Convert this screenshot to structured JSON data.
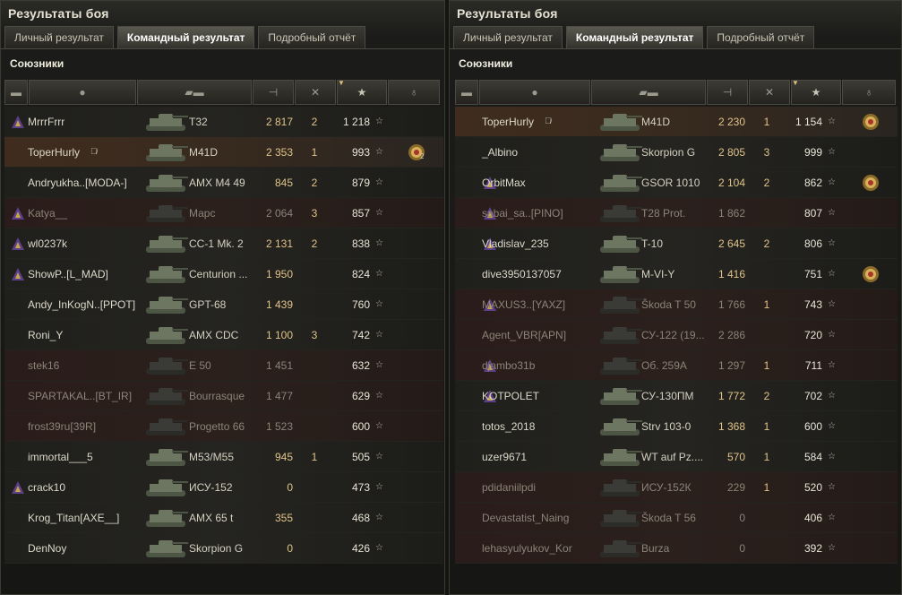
{
  "left": {
    "title": "Результаты боя",
    "tabs": [
      "Личный результат",
      "Командный результат",
      "Подробный отчёт"
    ],
    "active_tab": 1,
    "section": "Союзники",
    "rows": [
      {
        "name": "MrrrFrrr",
        "vehicle": "T32",
        "damage": "2 817",
        "kills": "2",
        "exp": "1 218",
        "badge": "clan",
        "state": "normal"
      },
      {
        "name": "ToperHurly",
        "vehicle": "M41D",
        "damage": "2 353",
        "kills": "1",
        "exp": "993",
        "state": "self",
        "eye": true,
        "medal": "2"
      },
      {
        "name": "Andryukha..[MODA-]",
        "vehicle": "AMX M4 49",
        "damage": "845",
        "kills": "2",
        "exp": "879",
        "state": "normal"
      },
      {
        "name": "Katya__",
        "vehicle": "Марс",
        "damage": "2 064",
        "kills": "3",
        "exp": "857",
        "badge": "clan",
        "state": "dead"
      },
      {
        "name": "wl0237k",
        "vehicle": "CC-1 Mk. 2",
        "damage": "2 131",
        "kills": "2",
        "exp": "838",
        "badge": "clan",
        "state": "normal"
      },
      {
        "name": "ShowP..[L_MAD]",
        "vehicle": "Centurion ...",
        "damage": "1 950",
        "kills": "",
        "exp": "824",
        "badge": "clan",
        "state": "normal"
      },
      {
        "name": "Andy_InKogN..[PPOT]",
        "vehicle": "GPT-68",
        "damage": "1 439",
        "kills": "",
        "exp": "760",
        "state": "normal"
      },
      {
        "name": "Roni_Y",
        "vehicle": "AMX CDC",
        "damage": "1 100",
        "kills": "3",
        "exp": "742",
        "state": "normal"
      },
      {
        "name": "stek16",
        "vehicle": "E 50",
        "damage": "1 451",
        "kills": "",
        "exp": "632",
        "state": "dead"
      },
      {
        "name": "SPARTAKAL..[BT_IR]",
        "vehicle": "Bourrasque",
        "damage": "1 477",
        "kills": "",
        "exp": "629",
        "state": "dead"
      },
      {
        "name": "frost39ru[39R]",
        "vehicle": "Progetto 66",
        "damage": "1 523",
        "kills": "",
        "exp": "600",
        "state": "dead"
      },
      {
        "name": "immortal___5",
        "vehicle": "M53/M55",
        "damage": "945",
        "kills": "1",
        "exp": "505",
        "state": "normal"
      },
      {
        "name": "crack10",
        "vehicle": "ИСУ-152",
        "damage": "0",
        "kills": "",
        "exp": "473",
        "badge": "clan",
        "state": "normal"
      },
      {
        "name": "Krog_Titan[AXE__]",
        "vehicle": "AMX 65 t",
        "damage": "355",
        "kills": "",
        "exp": "468",
        "state": "normal"
      },
      {
        "name": "DenNoy",
        "vehicle": "Skorpion G",
        "damage": "0",
        "kills": "",
        "exp": "426",
        "state": "normal"
      }
    ]
  },
  "right": {
    "title": "Результаты боя",
    "tabs": [
      "Личный результат",
      "Командный результат",
      "Подробный отчёт"
    ],
    "active_tab": 1,
    "section": "Союзники",
    "rows": [
      {
        "name": "ToperHurly",
        "vehicle": "M41D",
        "damage": "2 230",
        "kills": "1",
        "exp": "1 154",
        "state": "self",
        "eye": true,
        "medal": ""
      },
      {
        "name": "_Albino",
        "vehicle": "Skorpion G",
        "damage": "2 805",
        "kills": "3",
        "exp": "999",
        "state": "normal"
      },
      {
        "name": "OrbitMax",
        "vehicle": "GSOR 1010",
        "damage": "2 104",
        "kills": "2",
        "exp": "862",
        "badge": "clan",
        "state": "normal",
        "medal": ""
      },
      {
        "name": "sabai_sa..[PINO]",
        "vehicle": "T28 Prot.",
        "damage": "1 862",
        "kills": "",
        "exp": "807",
        "badge": "clan",
        "state": "dead"
      },
      {
        "name": "Vladislav_235",
        "vehicle": "T-10",
        "damage": "2 645",
        "kills": "2",
        "exp": "806",
        "badge": "clan",
        "state": "normal"
      },
      {
        "name": "dive3950137057",
        "vehicle": "M-VI-Y",
        "damage": "1 416",
        "kills": "",
        "exp": "751",
        "state": "normal",
        "medal": ""
      },
      {
        "name": "MAXUS3..[YAXZ]",
        "vehicle": "Škoda T 50",
        "damage": "1 766",
        "kills": "1",
        "exp": "743",
        "badge": "clan",
        "state": "dead"
      },
      {
        "name": "Agent_VBR[APN]",
        "vehicle": "СУ-122 (19...",
        "damage": "2 286",
        "kills": "",
        "exp": "720",
        "state": "dead"
      },
      {
        "name": "djambo31b",
        "vehicle": "Об. 259А",
        "damage": "1 297",
        "kills": "1",
        "exp": "711",
        "badge": "clan",
        "state": "dead"
      },
      {
        "name": "KOTPOLET",
        "vehicle": "СУ-130ПМ",
        "damage": "1 772",
        "kills": "2",
        "exp": "702",
        "badge": "clan",
        "state": "normal"
      },
      {
        "name": "totos_2018",
        "vehicle": "Strv 103-0",
        "damage": "1 368",
        "kills": "1",
        "exp": "600",
        "state": "normal"
      },
      {
        "name": "uzer9671",
        "vehicle": "WT auf Pz....",
        "damage": "570",
        "kills": "1",
        "exp": "584",
        "state": "normal"
      },
      {
        "name": "pdidaniilpdi",
        "vehicle": "ИСУ-152К",
        "damage": "229",
        "kills": "1",
        "exp": "520",
        "state": "dead"
      },
      {
        "name": "Devastatist_Naing",
        "vehicle": "Škoda T 56",
        "damage": "0",
        "kills": "",
        "exp": "406",
        "state": "dead"
      },
      {
        "name": "lehasyulyukov_Kor",
        "vehicle": "Burza",
        "damage": "0",
        "kills": "",
        "exp": "392",
        "state": "dead"
      }
    ]
  },
  "colors": {
    "damage": "#e0c48a",
    "dead_row": "#2a1c1a",
    "self_row": "#3f2c1e"
  }
}
